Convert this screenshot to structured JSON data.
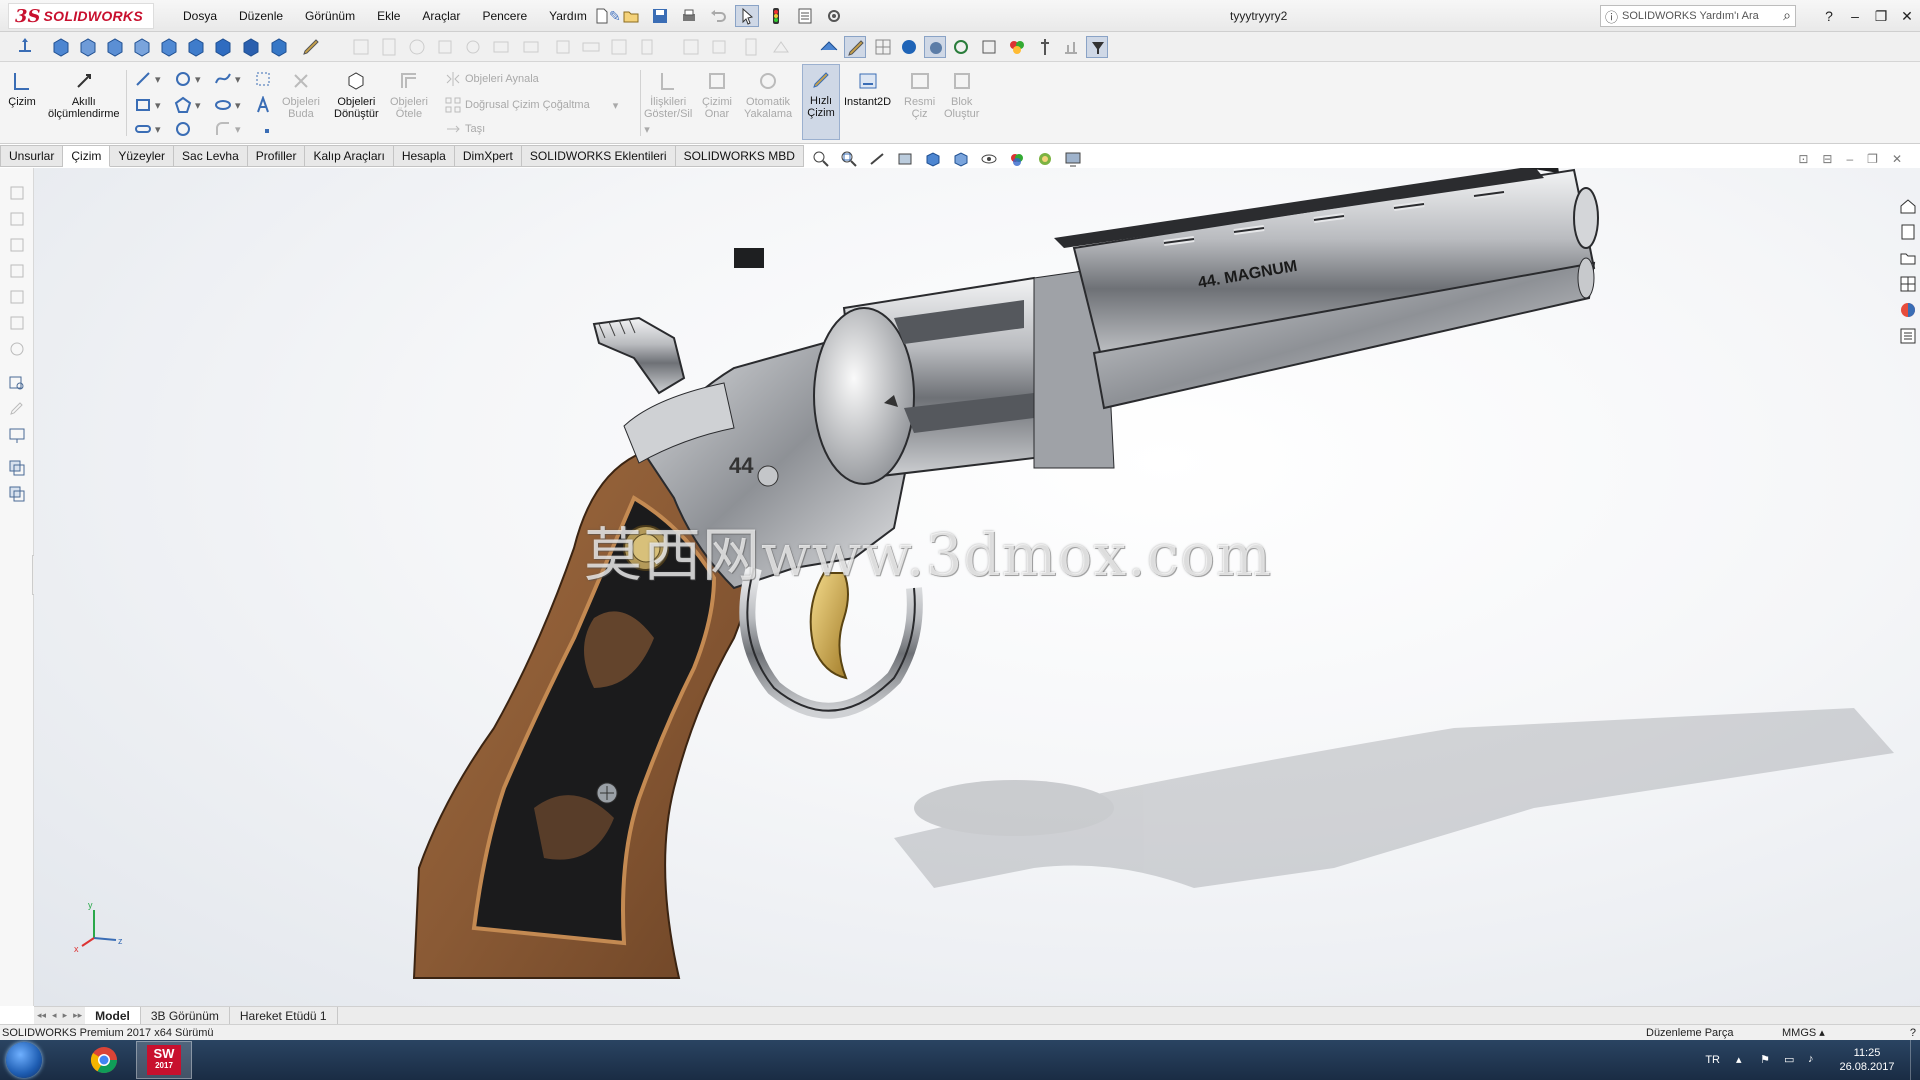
{
  "app": {
    "brand_ds": "3S",
    "brand_name": "SOLIDWORKS",
    "document_title": "tyyytryyry2",
    "help_search_placeholder": "SOLIDWORKS Yardım'ı Ara"
  },
  "menu": [
    "Dosya",
    "Düzenle",
    "Görünüm",
    "Ekle",
    "Araçlar",
    "Pencere",
    "Yardım"
  ],
  "ribbon": {
    "cizim": "Çizim",
    "akilli": "Akıllı\nölçümlendirme",
    "objeleri_buda": "Objeleri\nBuda",
    "objeleri_donustur": "Objeleri\nDönüştür",
    "objeleri_otele": "Objeleri\nÖtele",
    "objeleri_aynala": "Objeleri Aynala",
    "dogrusal": "Doğrusal Çizim Çoğaltma",
    "tasi": "Taşı",
    "iliskileri": "İlişkileri\nGöster/Sil",
    "cizimi_onar": "Çizimi\nOnar",
    "otomatik": "Otomatik\nYakalama",
    "hizli_cizim": "Hızlı\nÇizim",
    "instant2d": "Instant2D",
    "resmi_ciz": "Resmi\nÇiz",
    "blok": "Blok\nOluştur"
  },
  "tabs": [
    "Unsurlar",
    "Çizim",
    "Yüzeyler",
    "Sac Levha",
    "Profiller",
    "Kalıp Araçları",
    "Hesapla",
    "DimXpert",
    "SOLIDWORKS Eklentileri",
    "SOLIDWORKS MBD"
  ],
  "active_tab": "Çizim",
  "model": {
    "engraving": "44. MAGNUM",
    "cylinder_mark": "44",
    "watermark": "莫西网www.3dmox.com"
  },
  "bottom_tabs": [
    "Model",
    "3B Görünüm",
    "Hareket Etüdü 1"
  ],
  "status": {
    "version": "SOLIDWORKS Premium 2017 x64 Sürümü",
    "mode": "Düzenleme Parça",
    "units": "MMGS"
  },
  "taskbar": {
    "sw_badge": "2017",
    "language": "TR",
    "time": "11:25",
    "date": "26.08.2017"
  },
  "colors": {
    "brand_red": "#c8102e",
    "wood": "#8a5a35",
    "steel": "#b9bbbf",
    "trigger_gold": "#c7a24a"
  },
  "icons": [
    "search-icon",
    "help-icon",
    "new-file-icon",
    "open-icon",
    "save-icon",
    "print-icon",
    "undo-icon",
    "select-icon",
    "traffic-light-icon",
    "options-icon",
    "pin-icon"
  ]
}
